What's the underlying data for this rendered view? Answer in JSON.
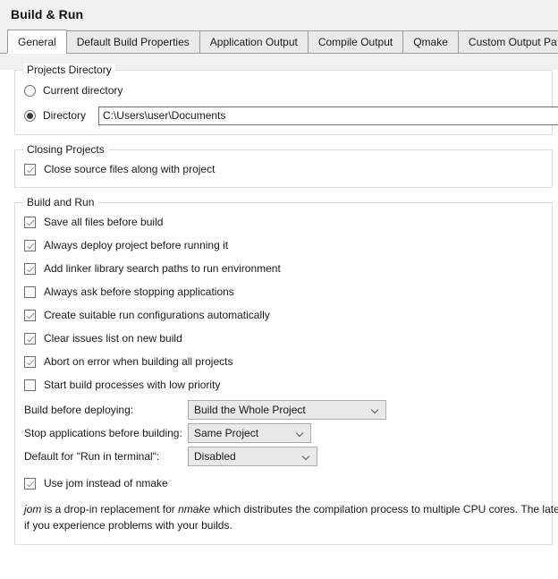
{
  "header": {
    "title": "Build & Run"
  },
  "tabs": [
    {
      "label": "General",
      "active": true
    },
    {
      "label": "Default Build Properties",
      "active": false
    },
    {
      "label": "Application Output",
      "active": false
    },
    {
      "label": "Compile Output",
      "active": false
    },
    {
      "label": "Qmake",
      "active": false
    },
    {
      "label": "Custom Output Pa",
      "active": false
    }
  ],
  "projects_directory": {
    "group_title": "Projects Directory",
    "current_directory_label": "Current directory",
    "current_directory_selected": false,
    "directory_label": "Directory",
    "directory_selected": true,
    "directory_value": "C:\\Users\\user\\Documents"
  },
  "closing_projects": {
    "group_title": "Closing Projects",
    "close_source_files_label": "Close source files along with project",
    "close_source_files_checked": true
  },
  "build_and_run": {
    "group_title": "Build and Run",
    "checkboxes": [
      {
        "label": "Save all files before build",
        "checked": true
      },
      {
        "label": "Always deploy project before running it",
        "checked": true
      },
      {
        "label": "Add linker library search paths to run environment",
        "checked": true
      },
      {
        "label": "Always ask before stopping applications",
        "checked": false
      },
      {
        "label": "Create suitable run configurations automatically",
        "checked": true
      },
      {
        "label": "Clear issues list on new build",
        "checked": true
      },
      {
        "label": "Abort on error when building all projects",
        "checked": true
      },
      {
        "label": "Start build processes with low priority",
        "checked": false
      }
    ],
    "build_before_deploying_label": "Build before deploying:",
    "build_before_deploying_value": "Build the Whole Project",
    "stop_applications_label": "Stop applications before building:",
    "stop_applications_value": "Same Project",
    "run_in_terminal_label": "Default for \"Run in terminal\":",
    "run_in_terminal_value": "Disabled",
    "use_jom_label": "Use jom instead of nmake",
    "use_jom_checked": true,
    "jom_description": {
      "line1_a": "jom",
      "line1_b": " is a drop-in replacement for ",
      "line1_c": "nmake",
      "line1_d": " which distributes the compilation process to multiple CPU cores. The lates",
      "line2": "if you experience problems with your builds."
    }
  },
  "icons": {
    "chevron_down": "chevron-down-icon",
    "checkmark": "checkmark-icon",
    "radio_dot": "radio-dot-icon"
  },
  "colors": {
    "window_background": "#f0f0f0",
    "pane_background": "#ffffff",
    "tab_inactive": "#eaeaea",
    "tab_border": "#9a9a9a",
    "group_border": "#dcdcdc",
    "control_border": "#6e6e6e",
    "combo_background": "#e9e9e9",
    "combo_border": "#adadad",
    "text": "#1a1a1a"
  }
}
